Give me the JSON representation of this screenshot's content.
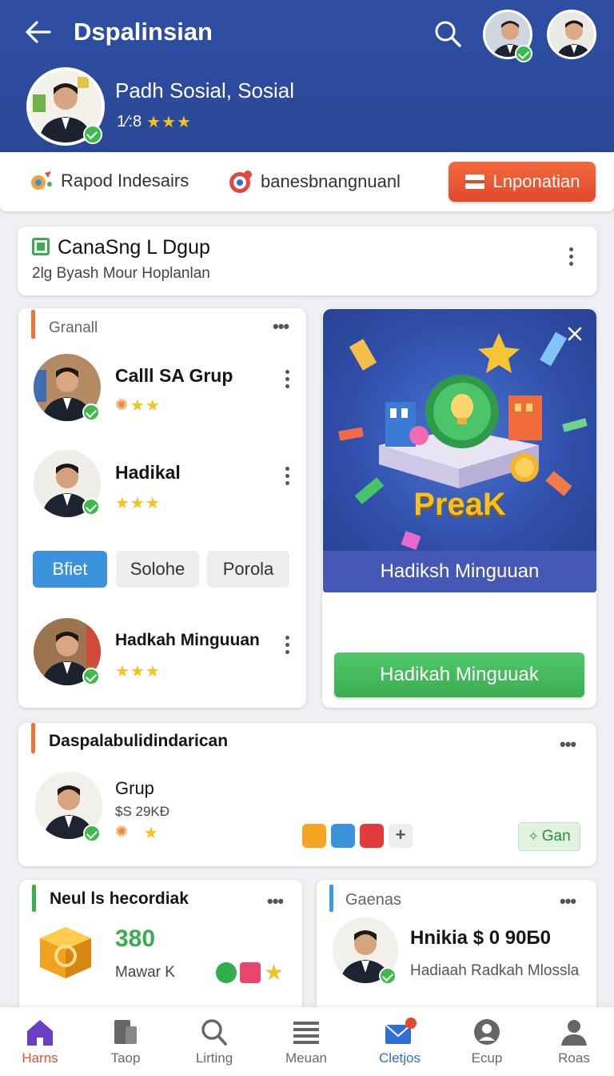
{
  "header": {
    "title": "Dspalinsian",
    "profile_name": "Padh Sosial, Sosial",
    "profile_count": "1⁄:8",
    "profile_stars": "★★★"
  },
  "toolbar": {
    "item1": "Rapod Indesairs",
    "item2": "banesbnangnuanl",
    "button": "Lnponatian"
  },
  "group_card": {
    "title": "CanaSng L Dgup",
    "subtitle": "2lg Byash Mour Hoplanlan"
  },
  "list_card": {
    "heading": "Granall",
    "members": [
      {
        "name": "Calll SA Grup",
        "stars": "★★"
      },
      {
        "name": "Hadikal",
        "stars": "★★★"
      },
      {
        "name": "Hadkah Minguuan",
        "stars": "★★★"
      }
    ],
    "chips": [
      "Bfiet",
      "Solohe",
      "Porola"
    ]
  },
  "promo": {
    "graphic_text": "PreaK",
    "caption": "Hadiksh Minguuan",
    "button": "Hadikah Minguuak"
  },
  "featured": {
    "heading": "Daspalabulidindarican",
    "name": "Grup",
    "price": "$S 29KÐ",
    "star": "★",
    "action": "Gan"
  },
  "bottom_left": {
    "heading": "Neul ls hecordiak",
    "value": "380",
    "label": "Mawar K"
  },
  "bottom_right": {
    "heading": "Gaenas",
    "name": "Hnikia $ 0 90Б0",
    "sub": "Hadiaah Radkah Mlossla"
  },
  "nav": {
    "items": [
      "Harns",
      "Taop",
      "Lirting",
      "Meuan",
      "Cletjos",
      "Ecup",
      "Roas"
    ],
    "active_index": 0,
    "active_color": "#e0522d",
    "accent_color": "#2f6fd6"
  },
  "colors": {
    "header_blue": "#2e4fa3",
    "accent_orange": "#f0703a",
    "accent_green": "#3aad50",
    "accent_blue": "#3b9be0",
    "star_gold": "#f7c21b"
  }
}
